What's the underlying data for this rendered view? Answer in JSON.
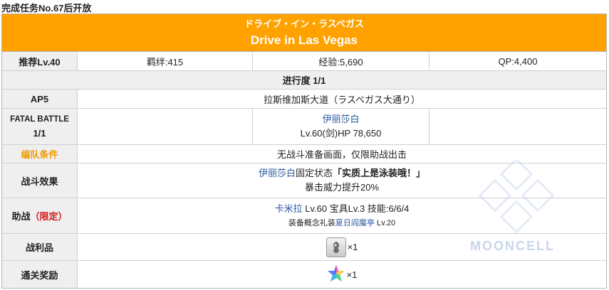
{
  "unlock_condition": "完成任务No.67后开放",
  "quest": {
    "title_jp": "ドライブ・イン・ラスベガス",
    "title_en": "Drive in Las Vegas"
  },
  "stats": {
    "recommended": "推荐Lv.40",
    "bond": "羁绊:415",
    "exp": "经验:5,690",
    "qp": "QP:4,400"
  },
  "progress": "进行度 1/1",
  "ap": {
    "label": "AP5",
    "location": "拉斯维加斯大道（ラスベガス大通り）"
  },
  "fatal": {
    "label_line1": "FATAL BATTLE",
    "label_line2": "1/1",
    "enemy_name": "伊丽莎白",
    "enemy_stats": "Lv.60(剑)HP 78,650"
  },
  "team": {
    "label": "编队条件",
    "value": "无战斗准备画面，仅限助战出击"
  },
  "effect": {
    "label": "战斗效果",
    "target": "伊丽莎白",
    "desc_mid": "固定状态",
    "status": "「实质上是泳装哦！」",
    "line2": "暴击威力提升20%"
  },
  "support": {
    "label": "助战",
    "label_note": "（限定）",
    "servant": "卡米拉",
    "servant_stats": " Lv.60 宝具Lv.3 技能:6/6/4",
    "ce_prefix": "装备概念礼装",
    "ce_name": "夏日阎魔亭",
    "ce_level": " Lv.20"
  },
  "loot": {
    "label": "战利品",
    "count": "×1"
  },
  "clear": {
    "label": "通关奖励",
    "count": "×1"
  },
  "watermark": "MOONCELL",
  "colors": {
    "header": "#ffa200",
    "label_bg": "#efefef",
    "link_blue": "#2a5a9c",
    "orange_label": "#f29b00",
    "red_note": "#d11a1a"
  }
}
